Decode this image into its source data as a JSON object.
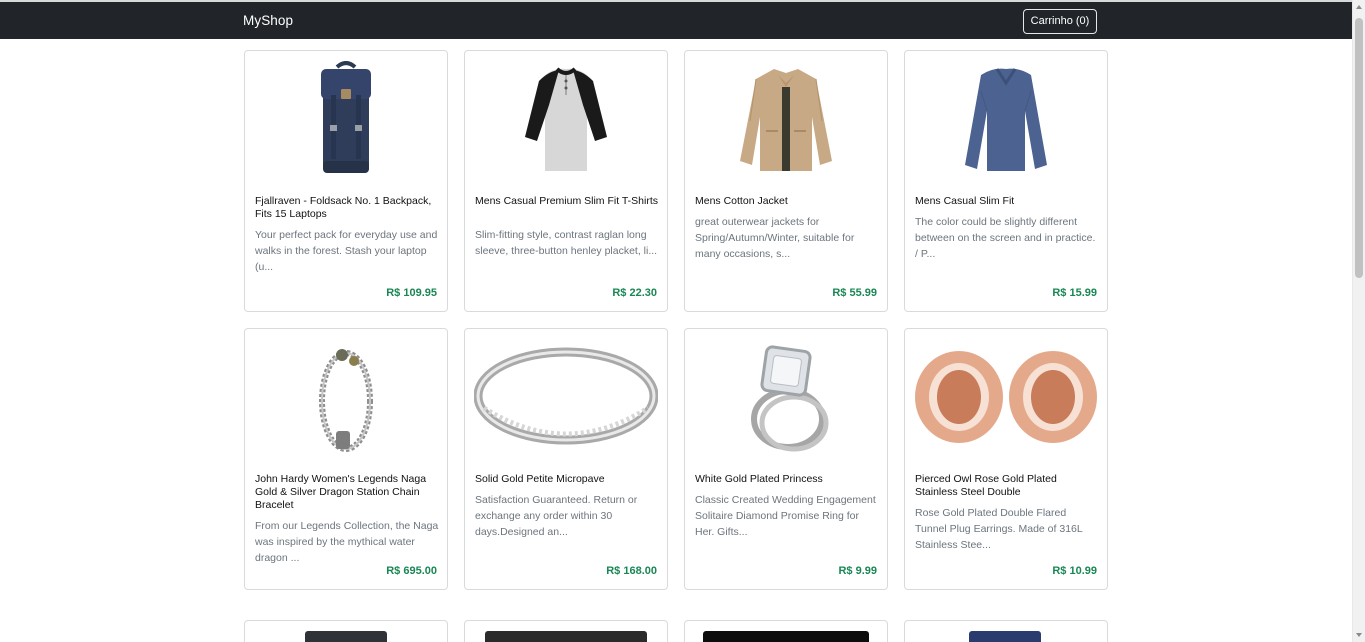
{
  "navbar": {
    "brand": "MyShop",
    "cart_label": "Carrinho (0)"
  },
  "products": [
    {
      "title": "Fjallraven - Foldsack No. 1 Backpack, Fits 15 Laptops",
      "description": "Your perfect pack for everyday use and walks in the forest. Stash your laptop (u...",
      "price": "R$ 109.95",
      "image": "backpack"
    },
    {
      "title": "Mens Casual Premium Slim Fit T-Shirts",
      "description": "Slim-fitting style, contrast raglan long sleeve, three-button henley placket, li...",
      "price": "R$ 22.30",
      "image": "raglan-shirt"
    },
    {
      "title": "Mens Cotton Jacket",
      "description": "great outerwear jackets for Spring/Autumn/Winter, suitable for many occasions, s...",
      "price": "R$ 55.99",
      "image": "jacket"
    },
    {
      "title": "Mens Casual Slim Fit",
      "description": "The color could be slightly different between on the screen and in practice. / P...",
      "price": "R$ 15.99",
      "image": "long-sleeve-shirt"
    },
    {
      "title": "John Hardy Women's Legends Naga Gold & Silver Dragon Station Chain Bracelet",
      "description": "From our Legends Collection, the Naga was inspired by the mythical water dragon ...",
      "price": "R$ 695.00",
      "image": "bracelet"
    },
    {
      "title": "Solid Gold Petite Micropave",
      "description": "Satisfaction Guaranteed. Return or exchange any order within 30 days.Designed an...",
      "price": "R$ 168.00",
      "image": "ring-band"
    },
    {
      "title": "White Gold Plated Princess",
      "description": "Classic Created Wedding Engagement Solitaire Diamond Promise Ring for Her. Gifts...",
      "price": "R$ 9.99",
      "image": "diamond-ring"
    },
    {
      "title": "Pierced Owl Rose Gold Plated Stainless Steel Double",
      "description": "Rose Gold Plated Double Flared Tunnel Plug Earrings. Made of 316L Stainless Stee...",
      "price": "R$ 10.99",
      "image": "plug-earrings"
    }
  ],
  "colors": {
    "navbar": "#212529",
    "price": "#198754",
    "muted_text": "#6c757d"
  }
}
